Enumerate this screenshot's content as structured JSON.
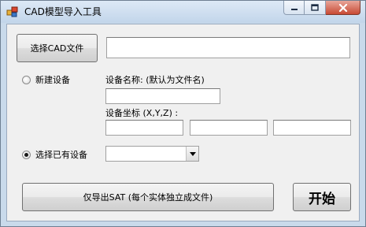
{
  "window": {
    "title": "CAD模型导入工具"
  },
  "toolbar": {
    "select_cad_file_label": "选择CAD文件",
    "file_path_value": ""
  },
  "new_device": {
    "radio_label": "新建设备",
    "checked": false,
    "name_label": "设备名称: (默认为文件名)",
    "name_value": "",
    "coord_label": "设备坐标 (X,Y,Z) :",
    "x_value": "",
    "y_value": "",
    "z_value": ""
  },
  "existing_device": {
    "radio_label": "选择已有设备",
    "checked": true,
    "selected_value": ""
  },
  "actions": {
    "export_sat_label": "仅导出SAT (每个实体独立成文件)",
    "start_label": "开始"
  },
  "colors": {
    "client_bg": "#f0f0f0",
    "titlebar": "#c9daeb",
    "close_button": "#c84a34"
  },
  "icons": {
    "app": "app-icon",
    "minimize": "minimize-icon",
    "maximize": "maximize-icon",
    "close": "close-icon",
    "dropdown": "chevron-down-icon"
  }
}
